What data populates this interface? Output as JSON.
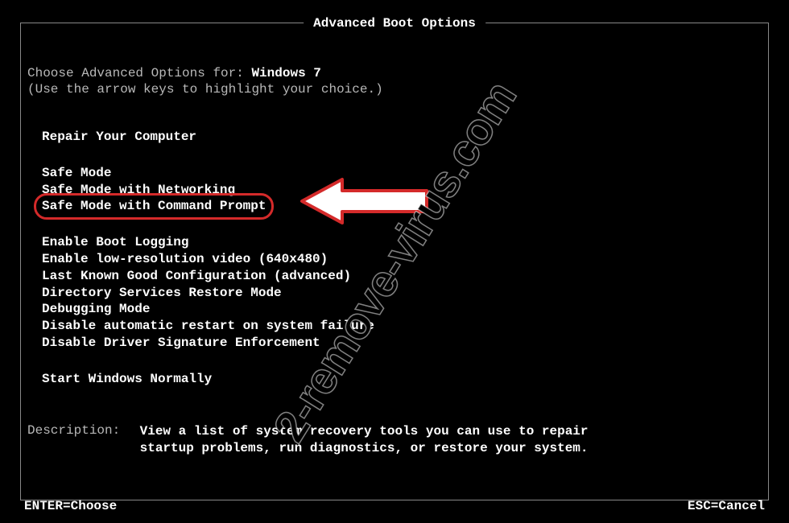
{
  "title": "Advanced Boot Options",
  "intro": {
    "prefix": "Choose Advanced Options for: ",
    "os": "Windows 7"
  },
  "hint": "(Use the arrow keys to highlight your choice.)",
  "menu": {
    "group1": [
      "Repair Your Computer"
    ],
    "group2": [
      "Safe Mode",
      "Safe Mode with Networking",
      "Safe Mode with Command Prompt"
    ],
    "group3": [
      "Enable Boot Logging",
      "Enable low-resolution video (640x480)",
      "Last Known Good Configuration (advanced)",
      "Directory Services Restore Mode",
      "Debugging Mode",
      "Disable automatic restart on system failure",
      "Disable Driver Signature Enforcement"
    ],
    "group4": [
      "Start Windows Normally"
    ]
  },
  "highlighted_index": 2,
  "description": {
    "label": "Description:",
    "text": "View a list of system recovery tools you can use to repair startup problems, run diagnostics, or restore your system."
  },
  "footer": {
    "enter": "ENTER=Choose",
    "esc": "ESC=Cancel"
  },
  "watermark": "2-remove-virus.com"
}
